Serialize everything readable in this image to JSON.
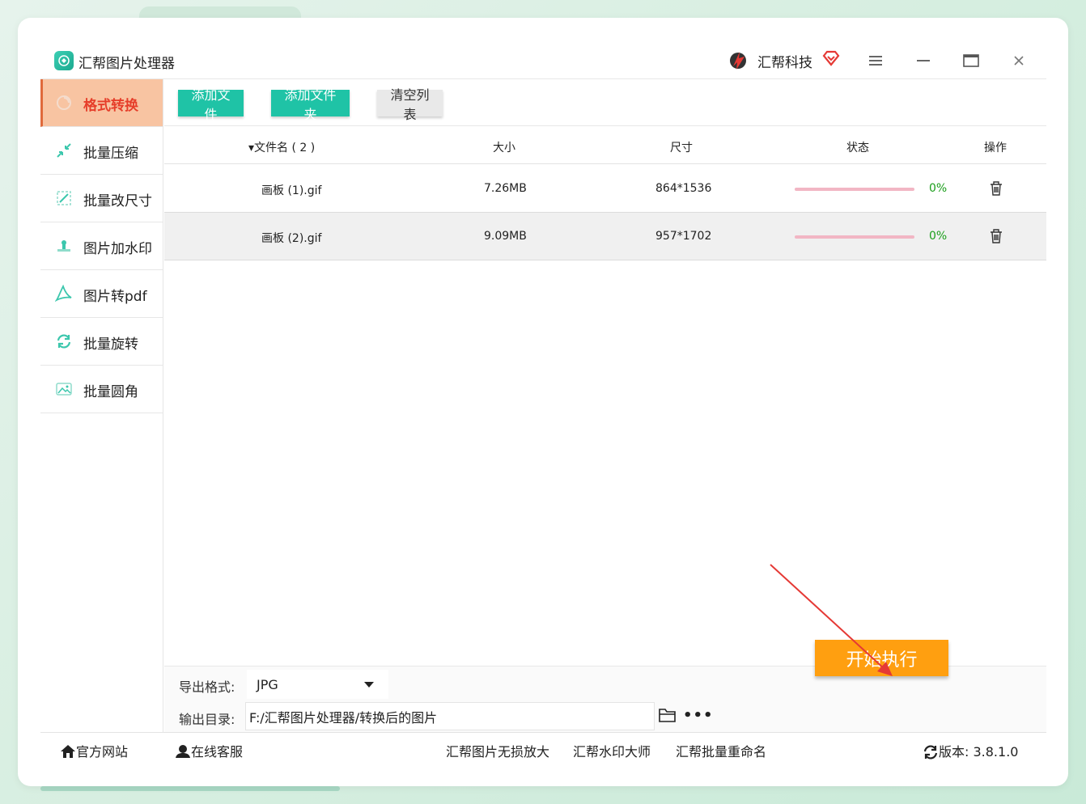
{
  "app": {
    "title": "汇帮图片处理器",
    "brand": "汇帮科技"
  },
  "sidebar": {
    "items": [
      {
        "label": "格式转换",
        "icon": "format-convert-icon",
        "active": true
      },
      {
        "label": "批量压缩",
        "icon": "compress-icon"
      },
      {
        "label": "批量改尺寸",
        "icon": "resize-icon"
      },
      {
        "label": "图片加水印",
        "icon": "watermark-icon"
      },
      {
        "label": "图片转pdf",
        "icon": "pdf-icon"
      },
      {
        "label": "批量旋转",
        "icon": "rotate-icon"
      },
      {
        "label": "批量圆角",
        "icon": "round-corner-icon"
      }
    ]
  },
  "toolbar": {
    "add_file": "添加文件",
    "add_folder": "添加文件夹",
    "clear_list": "清空列表"
  },
  "table": {
    "headers": {
      "name": "文件名 ( 2 )",
      "size": "大小",
      "dims": "尺寸",
      "status": "状态",
      "action": "操作"
    },
    "rows": [
      {
        "name": "画板 (1).gif",
        "size": "7.26MB",
        "dims": "864*1536",
        "progress": 0,
        "pct": "0%"
      },
      {
        "name": "画板 (2).gif",
        "size": "9.09MB",
        "dims": "957*1702",
        "progress": 0,
        "pct": "0%"
      }
    ]
  },
  "settings": {
    "format_label": "导出格式:",
    "format_value": "JPG",
    "outdir_label": "输出目录:",
    "outdir_value": "F:/汇帮图片处理器/转换后的图片",
    "more": "•••"
  },
  "start_button": "开始执行",
  "footer": {
    "website": "官方网站",
    "support": "在线客服",
    "link1": "汇帮图片无损放大",
    "link2": "汇帮水印大师",
    "link3": "汇帮批量重命名",
    "version": "版本: 3.8.1.0"
  },
  "colors": {
    "accent": "#1fc3a6",
    "active_bg": "#f8c4a2",
    "start": "#ff9f10",
    "arrow": "#e53935"
  }
}
